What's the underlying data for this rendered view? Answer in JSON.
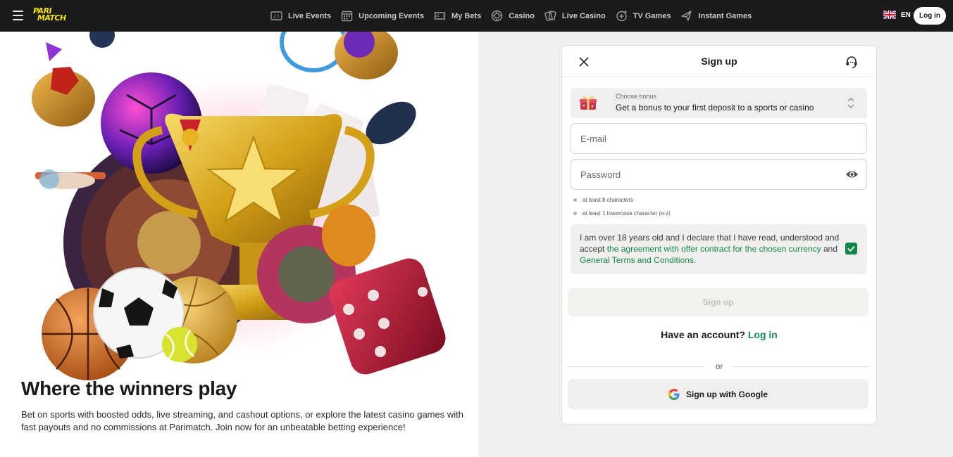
{
  "header": {
    "logo_text_top": "PARI",
    "logo_text_bottom": "MATCH",
    "nav": [
      {
        "label": "Live Events",
        "icon": "live-events-icon"
      },
      {
        "label": "Upcoming Events",
        "icon": "calendar-icon"
      },
      {
        "label": "My Bets",
        "icon": "ticket-icon"
      },
      {
        "label": "Casino",
        "icon": "casino-chip-icon"
      },
      {
        "label": "Live Casino",
        "icon": "cards-icon"
      },
      {
        "label": "TV Games",
        "icon": "tv-games-icon"
      },
      {
        "label": "Instant Games",
        "icon": "plane-icon"
      }
    ],
    "language": "EN",
    "login_label": "Log in"
  },
  "promo": {
    "title": "Where the winners play",
    "description": "Bet on sports with boosted odds, live streaming, and cashout options, or explore the latest casino games with fast payouts and no commissions at Parimatch. Join now for an unbeatable betting experience!"
  },
  "signup": {
    "title": "Sign up",
    "bonus": {
      "caption": "Choose bonus",
      "selected": "Get a bonus to your first deposit to a sports or casino"
    },
    "email_placeholder": "E-mail",
    "password_placeholder": "Password",
    "password_rules": [
      "at least 8 characters",
      "at least 1 lowercase character (a-z)"
    ],
    "agreement": {
      "prefix": "I am over 18 years old and I declare that I have read, understood and accept ",
      "link_agreement": "the agreement with offer contract for the chosen currency",
      "and": " and ",
      "link_terms": "General Terms and Conditions",
      "suffix": ".",
      "checked": true
    },
    "submit_label": "Sign up",
    "have_account": "Have an account?",
    "login_link": "Log in",
    "or": "or",
    "google_label": "Sign up with Google"
  },
  "colors": {
    "brand_yellow": "#f5e50a",
    "topbar": "#1a1a1a",
    "accent_green": "#148a4c"
  }
}
